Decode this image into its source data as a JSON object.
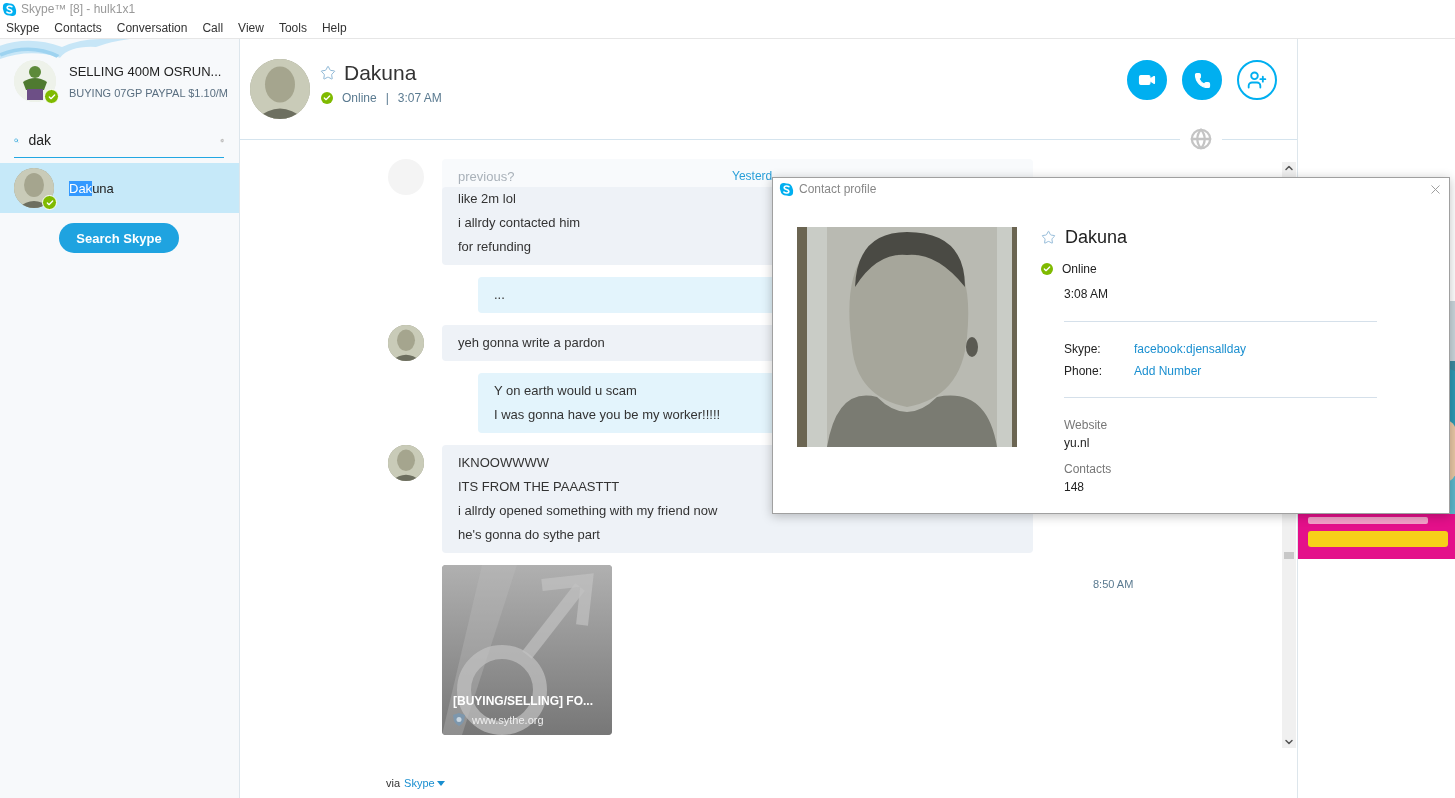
{
  "window": {
    "title": "Skype™ [8] - hulk1x1"
  },
  "menu": [
    "Skype",
    "Contacts",
    "Conversation",
    "Call",
    "View",
    "Tools",
    "Help"
  ],
  "profile": {
    "name": "SELLING 400M OSRUN...",
    "mood": "BUYING 07GP PAYPAL $1.10/M",
    "online": true
  },
  "search": {
    "value": "dak"
  },
  "results": [
    {
      "match": "Dak",
      "rest": "una",
      "online": true,
      "selected": true
    }
  ],
  "search_button": "Search Skype",
  "conversation": {
    "name": "Dakuna",
    "favorite": false,
    "online": true,
    "status_text": "Online",
    "separator": "|",
    "local_time": "3:07 AM"
  },
  "messages": [
    {
      "kind": "incoming",
      "faded": true,
      "avatar": true,
      "lines": [
        "previous?"
      ],
      "time": "Yesterd"
    },
    {
      "kind": "incoming",
      "faded": false,
      "avatar": false,
      "lines": [
        "like 2m lol",
        "i allrdy contacted him",
        "for refunding"
      ]
    },
    {
      "kind": "outgoing",
      "faded": false,
      "avatar": false,
      "lines": [
        "..."
      ]
    },
    {
      "kind": "incoming",
      "faded": false,
      "avatar": true,
      "lines": [
        "yeh gonna write a pardon"
      ]
    },
    {
      "kind": "outgoing",
      "faded": false,
      "avatar": false,
      "lines": [
        "Y on earth would u scam",
        "I was gonna have you be my worker!!!!!"
      ]
    },
    {
      "kind": "incoming",
      "faded": false,
      "avatar": true,
      "lines": [
        "IKNOOWWWW",
        "ITS FROM THE PAAASTTT",
        "i allrdy opened something with my friend now",
        "he's gonna do sythe part"
      ]
    }
  ],
  "link_preview": {
    "title": "[BUYING/SELLING] FO...",
    "site": "www.sythe.org",
    "time": "8:50 AM"
  },
  "footer": {
    "via": "via",
    "service": "Skype"
  },
  "contact_profile": {
    "title": "Contact profile",
    "name": "Dakuna",
    "favorite": false,
    "online": true,
    "status_text": "Online",
    "local_time": "3:08 AM",
    "fields": [
      {
        "label": "Skype:",
        "value": "facebook:djensallday"
      },
      {
        "label": "Phone:",
        "value": "Add Number"
      }
    ],
    "details": [
      {
        "label": "Website",
        "value": "yu.nl"
      },
      {
        "label": "Contacts",
        "value": "148"
      }
    ]
  }
}
